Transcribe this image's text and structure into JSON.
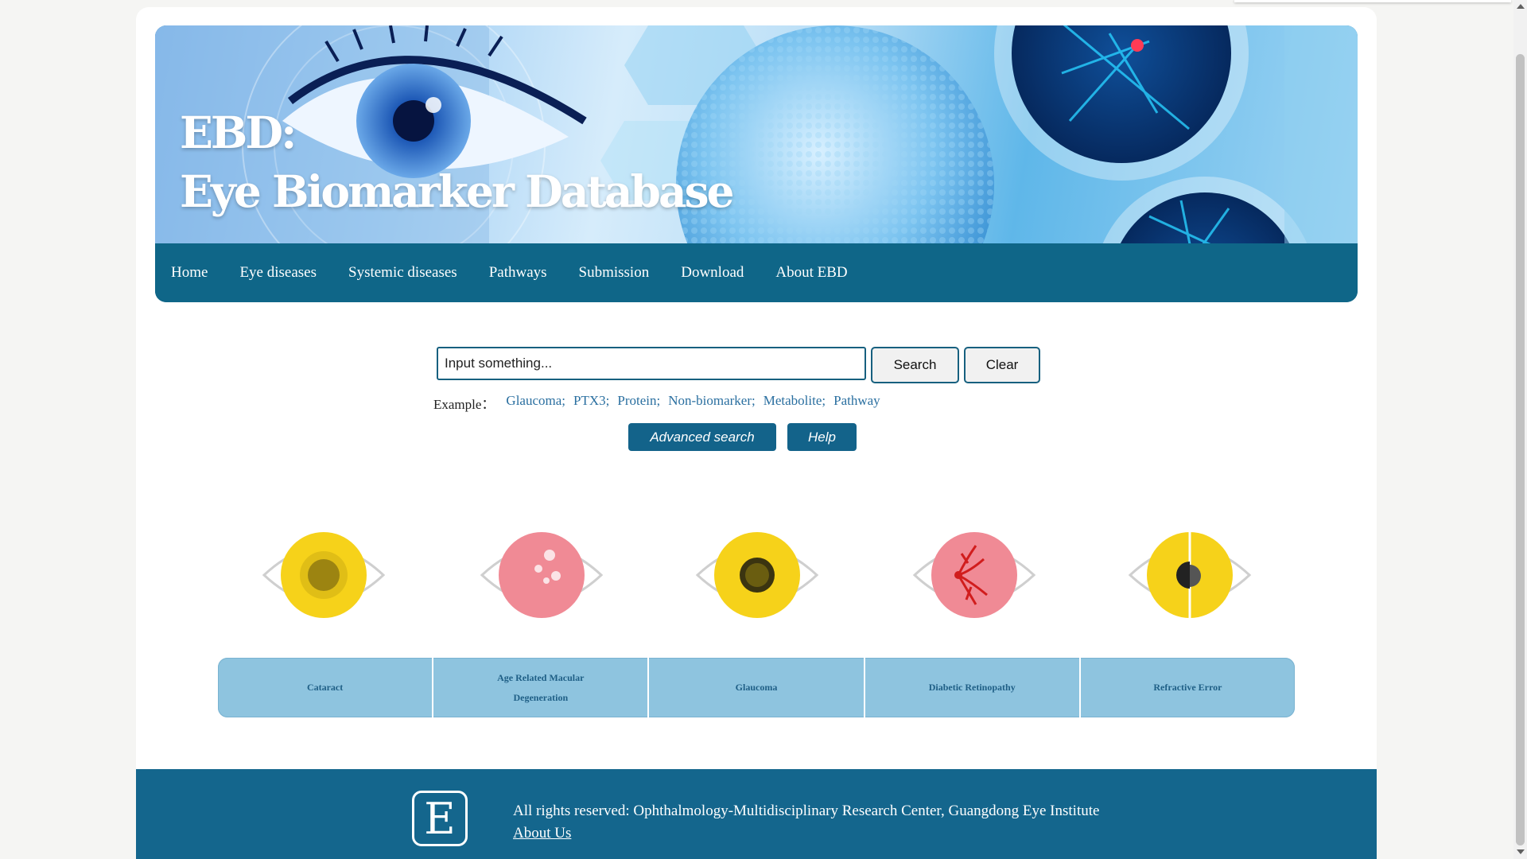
{
  "banner": {
    "title_line1": "EBD:",
    "title_line2": "Eye Biomarker Database"
  },
  "nav": {
    "items": [
      {
        "label": "Home"
      },
      {
        "label": "Eye diseases"
      },
      {
        "label": "Systemic diseases"
      },
      {
        "label": "Pathways"
      },
      {
        "label": "Submission"
      },
      {
        "label": "Download"
      },
      {
        "label": "About EBD"
      }
    ]
  },
  "search": {
    "placeholder": "Input something...",
    "search_label": "Search",
    "clear_label": "Clear",
    "example_label": "Example：",
    "examples": [
      "Glaucoma;",
      "PTX3;",
      "Protein;",
      "Non-biomarker;",
      "Metabolite;",
      "Pathway"
    ],
    "advanced_label": "Advanced search",
    "help_label": "Help"
  },
  "diseases": [
    {
      "label": "Cataract",
      "icon": "cataract-eye-icon"
    },
    {
      "label": "Age Related Macular Degeneration",
      "icon": "amd-eye-icon"
    },
    {
      "label": "Glaucoma",
      "icon": "glaucoma-eye-icon"
    },
    {
      "label": "Diabetic Retinopathy",
      "icon": "diabetic-retinopathy-eye-icon"
    },
    {
      "label": "Refractive Error",
      "icon": "refractive-error-eye-icon"
    }
  ],
  "footer": {
    "logo_letter": "E",
    "rights": "All rights reserved: Ophthalmology-Multidisciplinary Research Center, Guangdong Eye Institute",
    "about_link": "About Us"
  },
  "colors": {
    "nav_bg": "#0f6688",
    "footer_bg": "#14668d",
    "disease_bar": "#8ec4df",
    "iris_yellow": "#f6d21a",
    "iris_pink": "#f08a95"
  }
}
